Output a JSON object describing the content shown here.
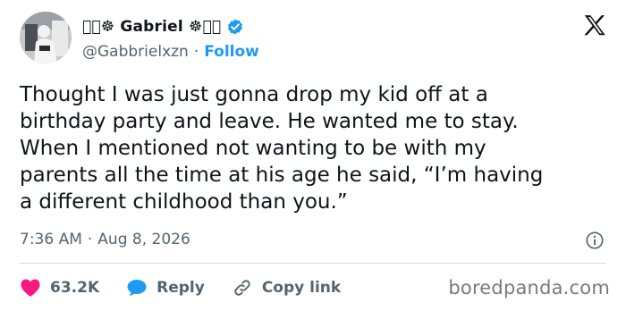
{
  "author": {
    "display_name": "\u0000\u0000☸ Gabriel ☸\u0000\u0000",
    "handle": "@Gabbrielxzn",
    "separator": "·",
    "follow_label": "Follow"
  },
  "tweet": {
    "lines": [
      "Thought I was just gonna drop my kid off at a",
      "birthday party and leave. He wanted me to stay.",
      "When I mentioned not wanting to be with my",
      "parents all the time at his age he said, “I’m having",
      "a different childhood than you.”"
    ],
    "time": "7:36 AM",
    "separator": "·",
    "date": "Aug 8, 2026"
  },
  "actions": {
    "likes": "63.2K",
    "reply_label": "Reply",
    "copy_link_label": "Copy link"
  },
  "watermark": "boredpanda.com",
  "colors": {
    "like_heart": "#f91880",
    "reply_bubble": "#1d9bf0",
    "verified": "#1d9bf0",
    "follow": "#1d9bf0",
    "secondary_text": "#536471"
  },
  "icons": [
    "verified-badge-icon",
    "x-logo-icon",
    "info-icon",
    "heart-icon",
    "reply-bubble-icon",
    "link-icon"
  ]
}
